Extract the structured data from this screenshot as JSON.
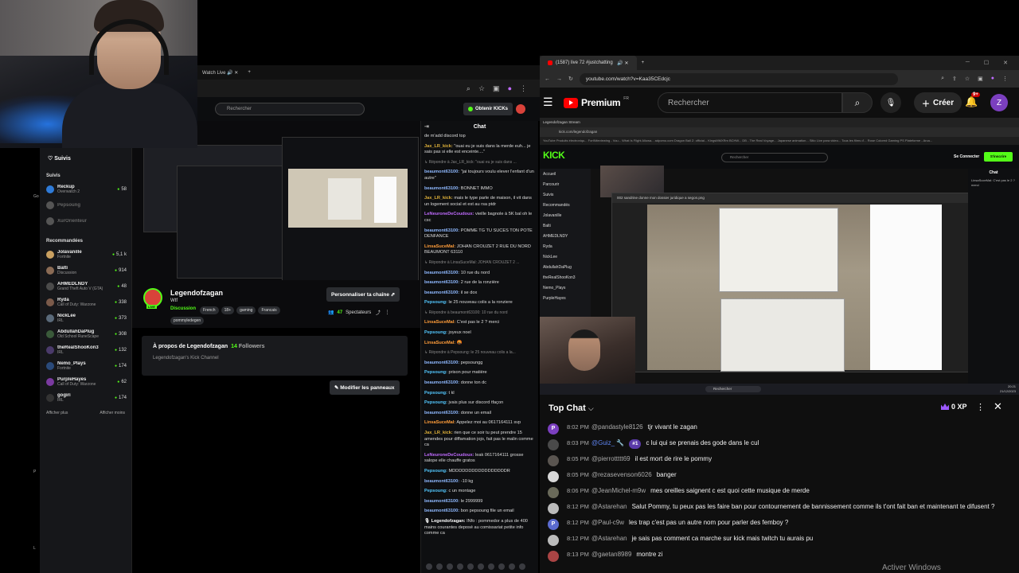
{
  "kick": {
    "top_tab": "Watch Live",
    "sidebar": {
      "header": "Suivis",
      "section_following": "Suivis",
      "following": [
        {
          "name": "Reckup",
          "game": "Overwatch 2",
          "viewers": "58",
          "color": "#2f7bd8",
          "online": true
        },
        {
          "name": "Pepsoung",
          "game": "",
          "viewers": "",
          "color": "#555",
          "online": false
        },
        {
          "name": "XurOrienteur",
          "game": "",
          "viewers": "",
          "color": "#555",
          "online": false
        }
      ],
      "section_recommended": "Recommandées",
      "recommended": [
        {
          "name": "Jolavanille",
          "game": "Fortnite",
          "viewers": "5,1 k",
          "color": "#c9a060"
        },
        {
          "name": "Balti",
          "game": "Discussion",
          "viewers": "914",
          "color": "#8a6b55"
        },
        {
          "name": "AHMEDLNDY",
          "game": "Grand Theft Auto V (GTA)",
          "viewers": "48",
          "color": "#4b4b4b"
        },
        {
          "name": "Ryda",
          "game": "Call of Duty: Warzone",
          "viewers": "338",
          "color": "#7a5a4a"
        },
        {
          "name": "NickLee",
          "game": "IRL",
          "viewers": "373",
          "color": "#5a6a7a"
        },
        {
          "name": "AbdullahDaPlug",
          "game": "Old School RuneScape",
          "viewers": "308",
          "color": "#3a5a3a"
        },
        {
          "name": "theRealShooKon3",
          "game": "IRL",
          "viewers": "132",
          "color": "#4a3a6a"
        },
        {
          "name": "Nemo_Plays",
          "game": "Fortnite",
          "viewers": "174",
          "color": "#2a4a7a"
        },
        {
          "name": "PurpleHayes",
          "game": "Call of Duty: Warzone",
          "viewers": "62",
          "color": "#7a3aa0"
        },
        {
          "name": "gogiri",
          "game": "IRL",
          "viewers": "174",
          "color": "#333"
        }
      ],
      "show_more": "Afficher plus",
      "show_less": "Afficher moins"
    },
    "search_placeholder": "Rechercher",
    "kicks_button": "Obtenir KICKs",
    "channel": {
      "name": "Legendofzagan",
      "subtitle": "Wtf",
      "live_badge": "LIVE",
      "category": "Discussion",
      "tags": [
        "French",
        "18+",
        "gaming",
        "Francais",
        "pommyledegen"
      ],
      "customize_button": "Personnaliser ta chaîne",
      "viewers": "47",
      "viewers_label": "Spectateurs"
    },
    "about": {
      "title": "À propos de Legendofzagan",
      "followers": "14",
      "followers_label": "Followers",
      "description": "Legendofzagan's Kick Channel"
    },
    "edit_panels_button": "Modifier les panneaux",
    "chat": {
      "title": "Chat",
      "messages": [
        {
          "user": "",
          "text": "de m'add discord top",
          "color": "#ddd"
        },
        {
          "user": "Jax_LR_kick:",
          "text": "\"ouai eu je suis dans la merde euh... je sais pas si elle est enceinte....\"",
          "color": "#e0b23a"
        },
        {
          "user": "",
          "text": "↳ Répondre à Jax_LR_kick: \"ouai eu je suis dans ...",
          "color": "#888",
          "reply": true
        },
        {
          "user": "beaumont63100:",
          "text": "\"jai toujours voulu elever l'enfant d'un autre\"",
          "color": "#8fb9ff"
        },
        {
          "user": "beaumont63100:",
          "text": "BONNET IMMO",
          "color": "#8fb9ff"
        },
        {
          "user": "Jax_LR_kick:",
          "text": "mais le type parle de maison, il vit dans un logement social et est au rsa ptdr",
          "color": "#e0b23a"
        },
        {
          "user": "LeNeuroneDeCoudoux:",
          "text": "vieille bagnole à 5K bal oh le csc",
          "color": "#c06bff"
        },
        {
          "user": "beaumont63100:",
          "text": "POMME TG TU SUCES TON POTE DENFANCE",
          "color": "#8fb9ff"
        },
        {
          "user": "LinsaSuceMal:",
          "text": "JOHAN CROUZET 2 RUE DU NORD BEAUMONT 63110",
          "color": "#ff9d3a"
        },
        {
          "user": "",
          "text": "↳ Répondre à LinsaSuceMal: JOHAN CROUZET 2 ...",
          "color": "#888",
          "reply": true
        },
        {
          "user": "beaumont63100:",
          "text": "10 rue du nord",
          "color": "#8fb9ff"
        },
        {
          "user": "beaumont63100:",
          "text": "2 rue de la ronzière",
          "color": "#8fb9ff"
        },
        {
          "user": "beaumont63100:",
          "text": "il se dox",
          "color": "#8fb9ff"
        },
        {
          "user": "Pepsoung:",
          "text": "le 25 nouveau colis a la ronziere",
          "color": "#53c8ff"
        },
        {
          "user": "",
          "text": "↳ Répondre à beaumont63100: 10 rue du nord",
          "color": "#888",
          "reply": true
        },
        {
          "user": "LinsaSuceMal:",
          "text": "C'est pas le 2 ? merci",
          "color": "#ff9d3a"
        },
        {
          "user": "Pepsoung:",
          "text": "joyeux noel",
          "color": "#53c8ff"
        },
        {
          "user": "LinsaSuceMal:",
          "text": "🤬",
          "color": "#ff9d3a"
        },
        {
          "user": "",
          "text": "↳ Répondre à Pepsoung: le 25 nouveau colis a la...",
          "color": "#888",
          "reply": true
        },
        {
          "user": "beaumont63100:",
          "text": "pepsoungg",
          "color": "#8fb9ff"
        },
        {
          "user": "Pepsoung:",
          "text": "prison pour matière",
          "color": "#53c8ff"
        },
        {
          "user": "beaumont63100:",
          "text": "donne ton dc",
          "color": "#8fb9ff"
        },
        {
          "user": "Pepsoung:",
          "text": "t kl",
          "color": "#53c8ff"
        },
        {
          "user": "Pepsoung:",
          "text": "jvais plus sur discord tfaçon",
          "color": "#53c8ff"
        },
        {
          "user": "beaumont63100:",
          "text": "donne un email",
          "color": "#8fb9ff"
        },
        {
          "user": "LinsaSuceMal:",
          "text": "Appelez moi au 0617164111 svp",
          "color": "#ff9d3a"
        },
        {
          "user": "Jax_LR_kick:",
          "text": "rien que ce soir tu peut prendre 15 amendes pour diffamation jojo, fait pas le malin comme ca",
          "color": "#e0b23a"
        },
        {
          "user": "LeNeuroneDeCoudoux:",
          "text": "leak 0617164111 grosse salope elle chauffe gratos",
          "color": "#c06bff"
        },
        {
          "user": "Pepsoung:",
          "text": "MDDDDDDDDDDDDDDDDDR",
          "color": "#53c8ff"
        },
        {
          "user": "beaumont63100:",
          "text": "-10 kg",
          "color": "#8fb9ff"
        },
        {
          "user": "Pepsoung:",
          "text": "c un montage",
          "color": "#53c8ff"
        },
        {
          "user": "beaumont63100:",
          "text": "le 2999999",
          "color": "#8fb9ff"
        },
        {
          "user": "beaumont63100:",
          "text": "bon pepsoung file un email",
          "color": "#8fb9ff"
        },
        {
          "user": "🎙 Legendofzagan:",
          "text": "INfo : pommedor a plus de 400 mains courantes deposé au comissariat petite info comme ca",
          "color": "#ffffff"
        }
      ]
    }
  },
  "youtube": {
    "tab_title": "(1587) live 72 #justchatting",
    "url": "youtube.com/watch?v=Kaa35CEdcjc",
    "logo_text": "Premium",
    "logo_region": "FR",
    "search_placeholder": "Rechercher",
    "create_button": "Créer",
    "notif_count": "9+",
    "avatar_letter": "Z",
    "video": {
      "inner_tab": "Legendofzagan Stream",
      "inner_url": "kick.com/legendofzagan",
      "bookmarks": "YouTube   Produits électroniqu...   FortNiteviewing - Vou...   What Is Flight Allowa...   adpomo.com   Dragon Ball Z: official...   KingsMMXRm BCHW...   DB - The Real Voyage...   Japanese animation...   Sitio Live para video...   Tous les films d'...   Rose Colored Gaming   PS Plateforme - Arca...",
      "kick_logo": "KICK",
      "inner_search": "Rechercher",
      "inner_connect": "Se Connecter",
      "inner_signup": "S'inscrire",
      "inner_side": [
        "Accueil",
        "Parcourir",
        "Suivis",
        "Recommandés",
        "Jolavanille",
        "Balti",
        "AHMEDLNDY",
        "Ryda",
        "NickLee",
        "AbdullahDaPlug",
        "theRealShooKon3",
        "Nemo_Plays",
        "PurpleHayes"
      ],
      "photo_toolbar": "002 sandrine donne mon dossier juridique a segon.png",
      "inner_chat_title": "Chat",
      "inner_chat_line": "LinsaSuceMal: C'est pas le 2 ? merci",
      "taskbar_search": "Rechercher",
      "clock_time": "20:21",
      "clock_date": "21/12/2023"
    },
    "chat": {
      "title": "Top Chat",
      "xp": "0 XP",
      "messages": [
        {
          "time": "8:02 PM",
          "author": "@pandastyle8126",
          "text": "tjr vivant le zagan",
          "avatar_color": "#7b3fbf",
          "avatar_letter": "P",
          "mod": false,
          "rank": ""
        },
        {
          "time": "8:03 PM",
          "author": "@Guiz_ 🔧",
          "text": "c lui qui se prenais des gode dans le cul",
          "avatar_color": "#4a4a4a",
          "avatar_letter": "",
          "mod": true,
          "rank": "#1"
        },
        {
          "time": "8:05 PM",
          "author": "@pierrottttt69",
          "text": "il est mort de rire le pommy",
          "avatar_color": "#5a5550",
          "avatar_letter": "",
          "mod": false,
          "rank": ""
        },
        {
          "time": "8:05 PM",
          "author": "@rezasevenson6026",
          "text": "banger",
          "avatar_color": "#d8d8d8",
          "avatar_letter": "",
          "mod": false,
          "rank": ""
        },
        {
          "time": "8:06 PM",
          "author": "@JeanMichel-m9w",
          "text": "mes oreilles saignent c est quoi cette musique de merde",
          "avatar_color": "#6a6a5a",
          "avatar_letter": "",
          "mod": false,
          "rank": ""
        },
        {
          "time": "8:12 PM",
          "author": "@Astarehan",
          "text": "Salut Pommy, tu peux pas les faire ban pour contournement de bannissement comme ils t'ont fait ban et maintenant te difusent ?",
          "avatar_color": "#bbbbbb",
          "avatar_letter": "",
          "mod": false,
          "rank": ""
        },
        {
          "time": "8:12 PM",
          "author": "@Paul-c9w",
          "text": "les trap c'est pas un autre nom pour parler des femboy ?",
          "avatar_color": "#5b6bd0",
          "avatar_letter": "P",
          "mod": false,
          "rank": ""
        },
        {
          "time": "8:12 PM",
          "author": "@Astarehan",
          "text": "je sais pas comment ca marche sur kick mais twitch tu aurais pu",
          "avatar_color": "#bbbbbb",
          "avatar_letter": "",
          "mod": false,
          "rank": ""
        },
        {
          "time": "8:13 PM",
          "author": "@gaetan8989",
          "text": "montre zi",
          "avatar_color": "#aa4444",
          "avatar_letter": "",
          "mod": false,
          "rank": ""
        }
      ]
    }
  },
  "os": {
    "activate_windows": "Activer Windows"
  }
}
